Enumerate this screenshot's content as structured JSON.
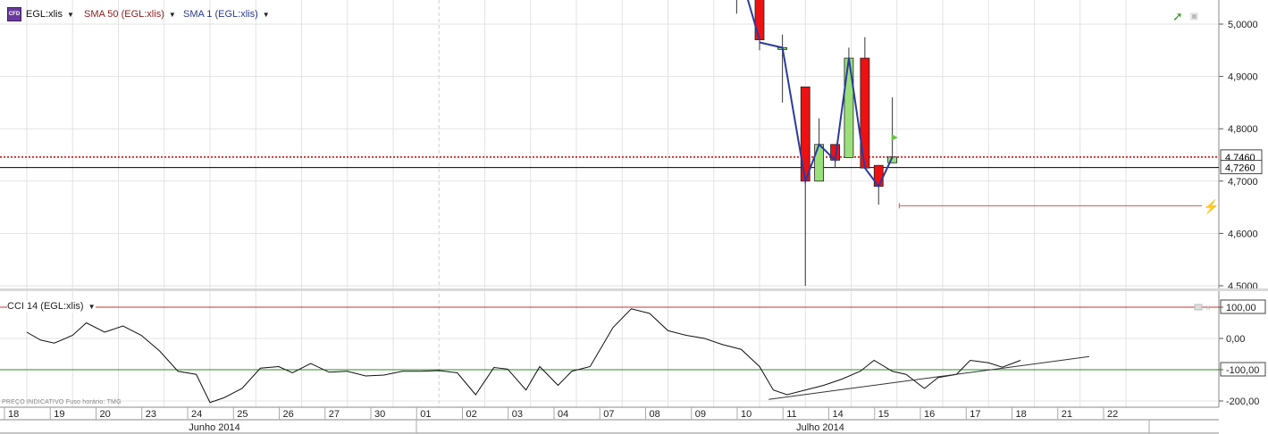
{
  "legend": {
    "instrument": "EGL:xlis",
    "instrument_icon_text": "CFD",
    "sma50": "SMA 50 (EGL:xlis)",
    "sma1": "SMA 1 (EGL:xlis)",
    "sma50_color": "#8b2020",
    "sma1_color": "#2b3b8f"
  },
  "cci_legend": "CCI 14 (EGL:xlis)",
  "footer_note": "PREÇO INDICATIVO   Fuso horário: TMG",
  "chart_data": {
    "type": "candlestick",
    "price_axis": {
      "ylim": [
        4.5,
        5.03
      ],
      "ticks": [
        "4,5000",
        "4,6000",
        "4,7000",
        "4,8000",
        "4,9000",
        "5,0000"
      ],
      "tick_values": [
        4.5,
        4.6,
        4.7,
        4.8,
        4.9,
        5.0
      ],
      "last_price_label": "4,7460",
      "last_price": 4.746,
      "reference_label": "4,7260",
      "reference_price": 4.726,
      "target_line_price": 4.653
    },
    "dates": [
      "18",
      "19",
      "20",
      "23",
      "24",
      "25",
      "26",
      "27",
      "30",
      "01",
      "02",
      "03",
      "04",
      "07",
      "08",
      "09",
      "10",
      "11",
      "14",
      "15",
      "16",
      "17",
      "18",
      "21",
      "22"
    ],
    "months": [
      {
        "label": "Junho 2014",
        "from": 0,
        "to": 8
      },
      {
        "label": "Julho 2014",
        "from": 9,
        "to": 24
      }
    ],
    "candles": [
      {
        "slot": 15.5,
        "open": 5.13,
        "close": 5.13,
        "high": 5.15,
        "low": 5.02
      },
      {
        "slot": 16.0,
        "open": 5.06,
        "close": 4.97,
        "high": 5.06,
        "low": 4.95
      },
      {
        "slot": 16.5,
        "open": 4.955,
        "close": 4.955,
        "high": 4.98,
        "low": 4.85
      },
      {
        "slot": 17.0,
        "open": 4.88,
        "close": 4.7,
        "high": 4.88,
        "low": 4.5
      },
      {
        "slot": 17.3,
        "open": 4.7,
        "close": 4.77,
        "high": 4.82,
        "low": 4.7
      },
      {
        "slot": 17.65,
        "open": 4.77,
        "close": 4.74,
        "high": 4.77,
        "low": 4.725
      },
      {
        "slot": 17.95,
        "open": 4.745,
        "close": 4.935,
        "high": 4.955,
        "low": 4.745
      },
      {
        "slot": 18.3,
        "open": 4.935,
        "close": 4.725,
        "high": 4.975,
        "low": 4.725
      },
      {
        "slot": 18.6,
        "open": 4.73,
        "close": 4.69,
        "high": 4.73,
        "low": 4.655
      },
      {
        "slot": 18.9,
        "open": 4.735,
        "close": 4.746,
        "high": 4.86,
        "low": 4.735
      }
    ],
    "sma1": [
      {
        "slot": 16.0,
        "value": 4.965
      },
      {
        "slot": 16.5,
        "value": 4.955
      },
      {
        "slot": 17.0,
        "value": 4.7
      },
      {
        "slot": 17.3,
        "value": 4.77
      },
      {
        "slot": 17.65,
        "value": 4.74
      },
      {
        "slot": 17.95,
        "value": 4.935
      },
      {
        "slot": 18.3,
        "value": 4.725
      },
      {
        "slot": 18.6,
        "value": 4.69
      },
      {
        "slot": 18.9,
        "value": 4.746
      }
    ],
    "cci": {
      "ylim": [
        -230,
        120
      ],
      "ticks": [
        "100,00",
        "0,00",
        "-100,00",
        "-200,00"
      ],
      "tick_values": [
        100,
        0,
        -100,
        -200
      ],
      "overbought": 100,
      "oversold": -100,
      "values": [
        {
          "slot": 0.0,
          "value": 20
        },
        {
          "slot": 0.3,
          "value": -5
        },
        {
          "slot": 0.6,
          "value": -15
        },
        {
          "slot": 1.0,
          "value": 10
        },
        {
          "slot": 1.3,
          "value": 50
        },
        {
          "slot": 1.7,
          "value": 20
        },
        {
          "slot": 2.1,
          "value": 40
        },
        {
          "slot": 2.5,
          "value": 10
        },
        {
          "slot": 2.9,
          "value": -40
        },
        {
          "slot": 3.3,
          "value": -105
        },
        {
          "slot": 3.7,
          "value": -115
        },
        {
          "slot": 4.0,
          "value": -205
        },
        {
          "slot": 4.3,
          "value": -190
        },
        {
          "slot": 4.7,
          "value": -160
        },
        {
          "slot": 5.1,
          "value": -95
        },
        {
          "slot": 5.5,
          "value": -90
        },
        {
          "slot": 5.8,
          "value": -110
        },
        {
          "slot": 6.2,
          "value": -80
        },
        {
          "slot": 6.6,
          "value": -108
        },
        {
          "slot": 7.0,
          "value": -105
        },
        {
          "slot": 7.4,
          "value": -120
        },
        {
          "slot": 7.8,
          "value": -117
        },
        {
          "slot": 8.2,
          "value": -105
        },
        {
          "slot": 8.6,
          "value": -105
        },
        {
          "slot": 9.0,
          "value": -103
        },
        {
          "slot": 9.4,
          "value": -110
        },
        {
          "slot": 9.8,
          "value": -180
        },
        {
          "slot": 10.2,
          "value": -93
        },
        {
          "slot": 10.5,
          "value": -98
        },
        {
          "slot": 10.9,
          "value": -165
        },
        {
          "slot": 11.2,
          "value": -90
        },
        {
          "slot": 11.6,
          "value": -150
        },
        {
          "slot": 11.9,
          "value": -105
        },
        {
          "slot": 12.3,
          "value": -90
        },
        {
          "slot": 12.8,
          "value": 35
        },
        {
          "slot": 13.2,
          "value": 95
        },
        {
          "slot": 13.6,
          "value": 80
        },
        {
          "slot": 14.0,
          "value": 25
        },
        {
          "slot": 14.4,
          "value": 10
        },
        {
          "slot": 14.8,
          "value": 0
        },
        {
          "slot": 15.2,
          "value": -20
        },
        {
          "slot": 15.6,
          "value": -35
        },
        {
          "slot": 16.0,
          "value": -90
        },
        {
          "slot": 16.3,
          "value": -165
        },
        {
          "slot": 16.6,
          "value": -180
        },
        {
          "slot": 17.0,
          "value": -165
        },
        {
          "slot": 17.4,
          "value": -150
        },
        {
          "slot": 17.8,
          "value": -130
        },
        {
          "slot": 18.2,
          "value": -105
        },
        {
          "slot": 18.5,
          "value": -70
        },
        {
          "slot": 18.9,
          "value": -105
        },
        {
          "slot": 19.2,
          "value": -115
        },
        {
          "slot": 19.6,
          "value": -160
        },
        {
          "slot": 19.9,
          "value": -125
        },
        {
          "slot": 20.3,
          "value": -115
        },
        {
          "slot": 20.6,
          "value": -70
        },
        {
          "slot": 21.0,
          "value": -78
        },
        {
          "slot": 21.3,
          "value": -92
        },
        {
          "slot": 21.7,
          "value": -70
        }
      ],
      "trendline": [
        {
          "slot": 16.2,
          "value": -195
        },
        {
          "slot": 23.2,
          "value": -58
        }
      ]
    }
  }
}
